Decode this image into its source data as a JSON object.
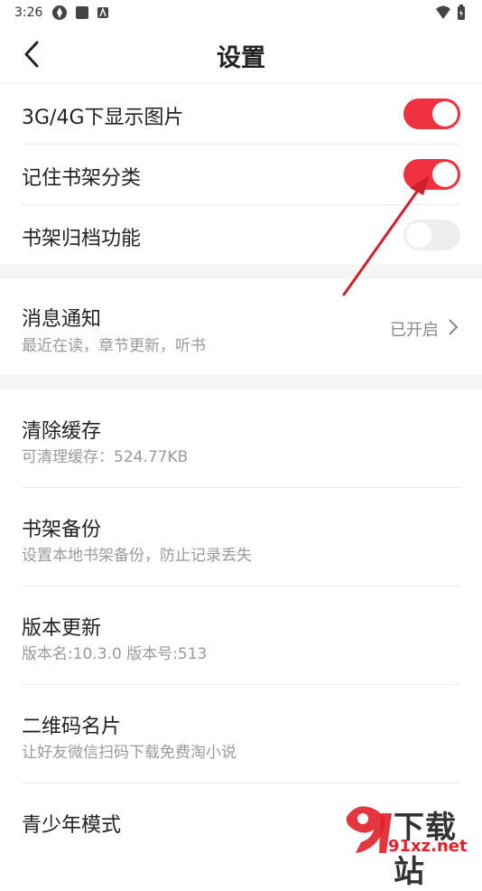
{
  "status_bar": {
    "time": "3:26"
  },
  "header": {
    "title": "设置"
  },
  "toggles": [
    {
      "label": "3G/4G下显示图片",
      "on": true
    },
    {
      "label": "记住书架分类",
      "on": true
    },
    {
      "label": "书架归档功能",
      "on": false
    }
  ],
  "notification": {
    "title": "消息通知",
    "subtitle": "最近在读，章节更新，听书",
    "value": "已开启"
  },
  "items": [
    {
      "title": "清除缓存",
      "subtitle": "可清理缓存：524.77KB"
    },
    {
      "title": "书架备份",
      "subtitle": "设置本地书架备份，防止记录丢失"
    },
    {
      "title": "版本更新",
      "subtitle": "版本名:10.3.0  版本号:513"
    },
    {
      "title": "二维码名片",
      "subtitle": "让好友微信扫码下载免费淘小说"
    },
    {
      "title": "青少年模式"
    }
  ],
  "watermark": {
    "brand": "下载站",
    "domain": "91xz.net"
  },
  "colors": {
    "accent": "#f0313f",
    "annotation_arrow": "#d0202a"
  }
}
